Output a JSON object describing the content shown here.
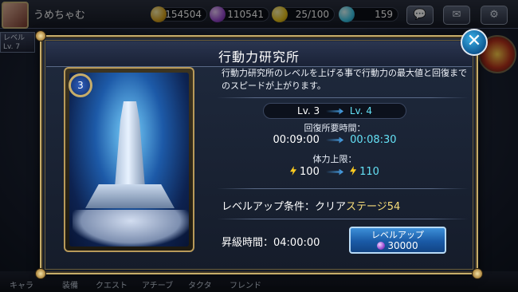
{
  "hud": {
    "player_name": "うめちゃむ",
    "gold": "154504",
    "gems": "110541",
    "stamina": "25/100",
    "diamonds": "159",
    "side_label_1": "レベル",
    "side_label_2": "Lv. 7"
  },
  "nav": {
    "items": [
      "キャラ",
      "装備",
      "クエスト",
      "アチーブ",
      "タクタ",
      "フレンド"
    ]
  },
  "dialog": {
    "title": "行動力研究所",
    "close_symbol": "✕",
    "card_level": "3",
    "description": "行動力研究所のレベルを上げる事で行動力の最大値と回復までのスピードが上がります。",
    "level_current": "Lv. 3",
    "level_next": "Lv. 4",
    "recovery_label": "回復所要時間：",
    "recovery_current": "00:09:00",
    "recovery_next": "00:08:30",
    "stamina_label": "体力上限：",
    "stamina_current": "100",
    "stamina_next": "110",
    "condition_prefix": "レベルアップ条件：クリア",
    "condition_stage": "ステージ54",
    "upgrade_time": "昇級時間：04:00:00",
    "levelup_button": "レベルアップ",
    "levelup_cost": "30000"
  }
}
